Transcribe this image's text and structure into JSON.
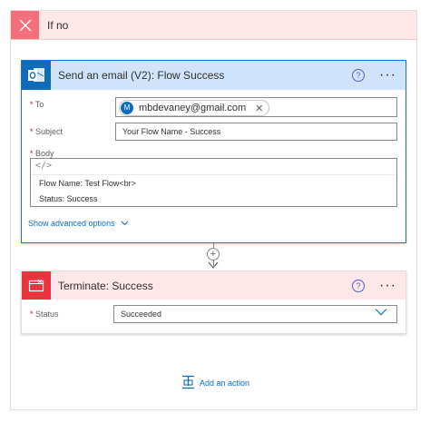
{
  "branch": {
    "title": "If no"
  },
  "email_action": {
    "title": "Send an email (V2): Flow Success",
    "help_icon": "?",
    "more_icon": "···",
    "to_label": "To",
    "to_avatar": "M",
    "to_email": "mbdevaney@gmail.com",
    "to_remove": "✕",
    "subject_label": "Subject",
    "subject_value": "Your Flow Name -  Success",
    "body_label": "Body",
    "code_toggle": "</>",
    "body_lines": [
      "Flow Name: Test Flow<br>",
      "Status: Success"
    ],
    "show_advanced": "Show advanced options",
    "required_marker": "*"
  },
  "connector": {
    "plus": "+"
  },
  "terminate_action": {
    "title": "Terminate: Success",
    "help_icon": "?",
    "more_icon": "···",
    "status_label": "Status",
    "status_value": "Succeeded",
    "required_marker": "*"
  },
  "add_action": {
    "label": "Add an action"
  },
  "colors": {
    "accent": "#0f6cbd",
    "email_header": "#cfe4fa",
    "terminate_header": "#fde7e9",
    "terminate_icon": "#e8343e",
    "branch_close": "#f1707b"
  }
}
